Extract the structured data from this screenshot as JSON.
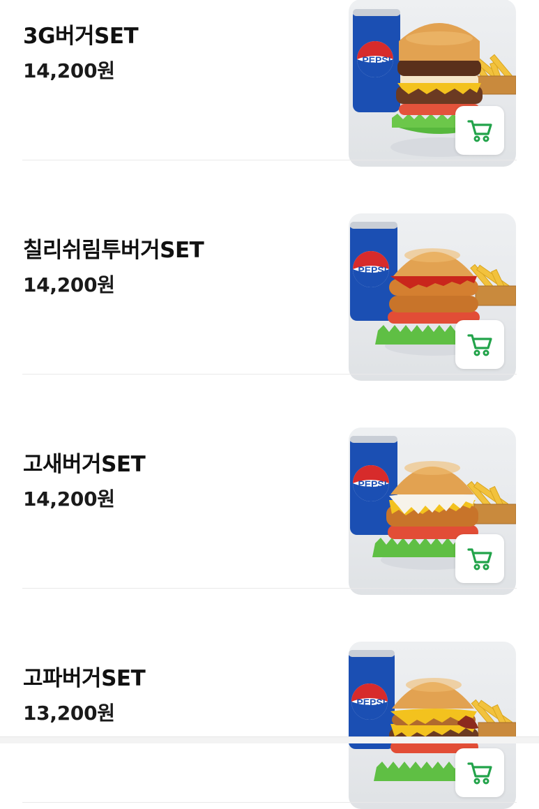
{
  "menu": {
    "items": [
      {
        "name": "3G버거SET",
        "price": "14,200원",
        "cart_icon": "cart-icon"
      },
      {
        "name": "칠리쉬림투버거SET",
        "price": "14,200원",
        "cart_icon": "cart-icon"
      },
      {
        "name": "고새버거SET",
        "price": "14,200원",
        "cart_icon": "cart-icon"
      },
      {
        "name": "고파버거SET",
        "price": "13,200원",
        "cart_icon": "cart-icon"
      }
    ]
  },
  "colors": {
    "accent": "#22a34a",
    "divider": "#e9e9e9",
    "pepsi_blue": "#1b4fb3",
    "pepsi_red": "#d72b2b"
  }
}
